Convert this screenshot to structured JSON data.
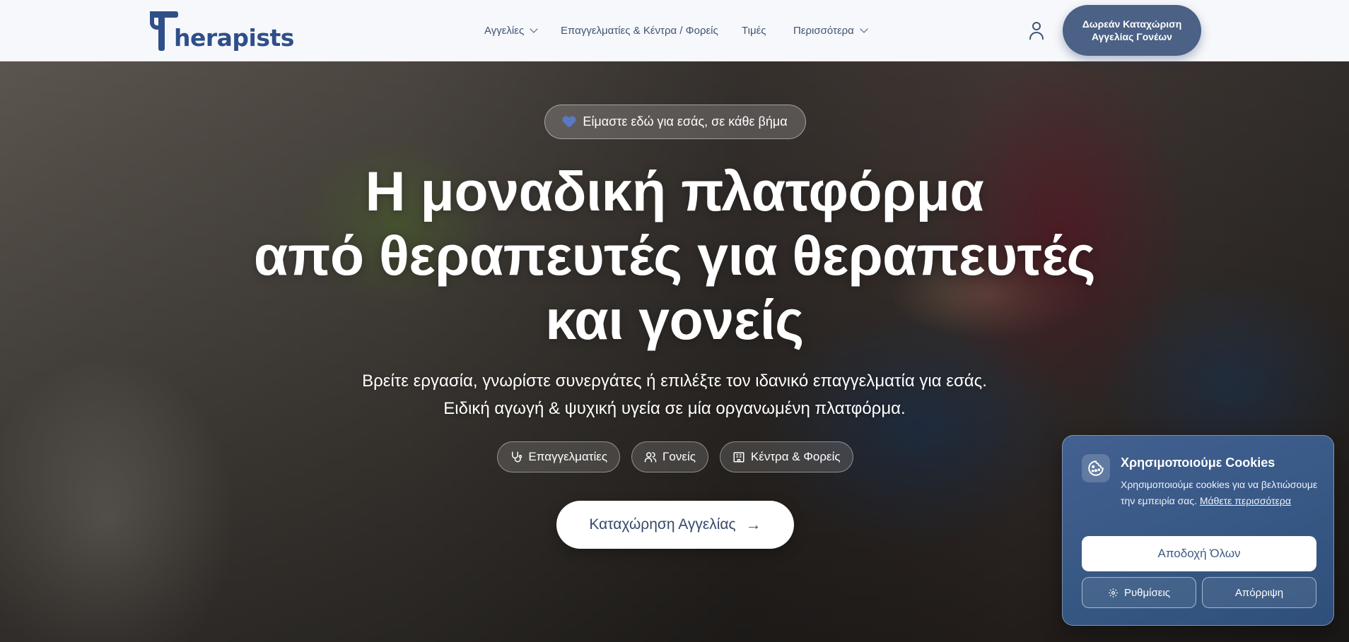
{
  "nav": {
    "logo_text": "herapists",
    "menu": [
      {
        "label": "Αγγελίες",
        "has_dropdown": true
      },
      {
        "label": "Επαγγελματίες & Κέντρα / Φορείς",
        "has_dropdown": false
      },
      {
        "label": "Τιμές",
        "has_dropdown": false
      },
      {
        "label": "Περισσότερα",
        "has_dropdown": true
      }
    ],
    "user_icon": "user-icon",
    "cta_label": "Δωρεάν Καταχώριση Αγγελίας Γονέων"
  },
  "hero": {
    "badge": "Είμαστε εδώ για εσάς, σε κάθε βήμα",
    "headline_lines": [
      "Η μοναδική πλατφόρμα",
      "από θεραπευτές για θεραπευτές",
      "και γονείς"
    ],
    "subline_lines": [
      "Βρείτε εργασία, γνωρίστε συνεργάτες ή επιλέξτε τον ιδανικό επαγγελματία για εσάς.",
      "Ειδική αγωγή & ψυχική υγεία σε μία οργανωμένη πλατφόρμα."
    ],
    "chips": [
      {
        "label": "Επαγγελματίες",
        "icon": "stethoscope-icon"
      },
      {
        "label": "Γονείς",
        "icon": "users-icon"
      },
      {
        "label": "Κέντρα & Φορείς",
        "icon": "building-icon"
      }
    ],
    "cta_label": "Καταχώρηση Αγγελίας",
    "cta_icon": "→"
  },
  "cookie": {
    "title": "Χρησιμοποιούμε Cookies",
    "text": "Χρησιμοποιούμε cookies για να βελτιώσουμε την εμπειρία σας.",
    "link": "Μάθετε περισσότερα",
    "accept_label": "Αποδοχή Όλων",
    "settings_label": "Ρυθμίσεις",
    "reject_label": "Απόρριψη"
  },
  "colors": {
    "brand": "#2f4f8a",
    "nav_text": "#3e5475",
    "cta_bg": "#4b6185",
    "cookie_bg": "#4669a0"
  }
}
